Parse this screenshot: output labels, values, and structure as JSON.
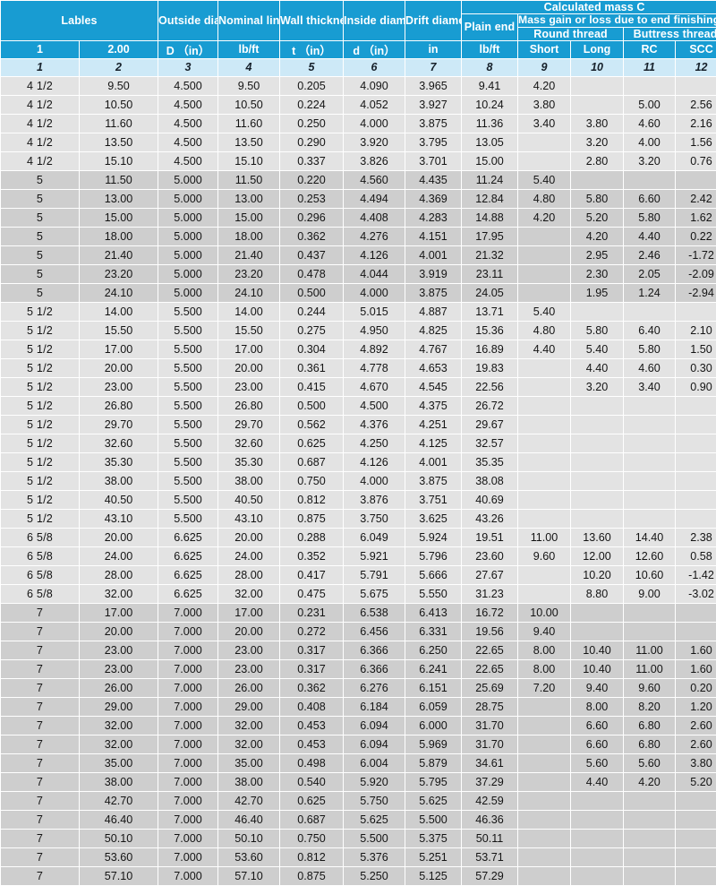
{
  "table": {
    "header": {
      "labels": "Lables",
      "outside_diameter": "Outside diameter",
      "nominal_linear_mass": "Nominal linear mass T&C",
      "wall_thickness": "Wall thickness",
      "inside_diameter": "Inside diameter",
      "drift_diameter": "Drift diameter",
      "calculated_mass": "Calculated mass C",
      "plain_end": "Plain end",
      "mass_gain_loss": "Mass gain or loss due to end finishing  (lb)",
      "round_thread": "Round thread",
      "buttress_thread": "Buttress thread"
    },
    "units_row": {
      "label1": "1",
      "label2": "2.00",
      "outside_diameter": "D （in）",
      "nominal_linear_mass": "lb/ft",
      "wall_thickness": "t （in）",
      "inside_diameter": "d （in）",
      "drift_diameter": "in",
      "plain_end": "lb/ft",
      "short": "Short",
      "long": "Long",
      "rc": "RC",
      "scc": "SCC"
    },
    "index_row": [
      "1",
      "2",
      "3",
      "4",
      "5",
      "6",
      "7",
      "8",
      "9",
      "10",
      "11",
      "12"
    ],
    "colors": {
      "header_blue": "#189CD2",
      "index_blue": "#CDE9F7",
      "band_light": "#E3E3E3",
      "band_dark": "#CECECE",
      "page_background": "#FFFFFF",
      "text": "#141414"
    },
    "rows": [
      {
        "band": "a",
        "cells": [
          "4 1/2",
          "9.50",
          "4.500",
          "9.50",
          "0.205",
          "4.090",
          "3.965",
          "9.41",
          "4.20",
          "",
          "",
          ""
        ]
      },
      {
        "band": "a",
        "cells": [
          "4 1/2",
          "10.50",
          "4.500",
          "10.50",
          "0.224",
          "4.052",
          "3.927",
          "10.24",
          "3.80",
          "",
          "5.00",
          "2.56"
        ]
      },
      {
        "band": "a",
        "cells": [
          "4 1/2",
          "11.60",
          "4.500",
          "11.60",
          "0.250",
          "4.000",
          "3.875",
          "11.36",
          "3.40",
          "3.80",
          "4.60",
          "2.16"
        ]
      },
      {
        "band": "a",
        "cells": [
          "4 1/2",
          "13.50",
          "4.500",
          "13.50",
          "0.290",
          "3.920",
          "3.795",
          "13.05",
          "",
          "3.20",
          "4.00",
          "1.56"
        ]
      },
      {
        "band": "a",
        "cells": [
          "4 1/2",
          "15.10",
          "4.500",
          "15.10",
          "0.337",
          "3.826",
          "3.701",
          "15.00",
          "",
          "2.80",
          "3.20",
          "0.76"
        ]
      },
      {
        "band": "b",
        "cells": [
          "5",
          "11.50",
          "5.000",
          "11.50",
          "0.220",
          "4.560",
          "4.435",
          "11.24",
          "5.40",
          "",
          "",
          ""
        ]
      },
      {
        "band": "b",
        "cells": [
          "5",
          "13.00",
          "5.000",
          "13.00",
          "0.253",
          "4.494",
          "4.369",
          "12.84",
          "4.80",
          "5.80",
          "6.60",
          "2.42"
        ]
      },
      {
        "band": "b",
        "cells": [
          "5",
          "15.00",
          "5.000",
          "15.00",
          "0.296",
          "4.408",
          "4.283",
          "14.88",
          "4.20",
          "5.20",
          "5.80",
          "1.62"
        ]
      },
      {
        "band": "b",
        "cells": [
          "5",
          "18.00",
          "5.000",
          "18.00",
          "0.362",
          "4.276",
          "4.151",
          "17.95",
          "",
          "4.20",
          "4.40",
          "0.22"
        ]
      },
      {
        "band": "b",
        "cells": [
          "5",
          "21.40",
          "5.000",
          "21.40",
          "0.437",
          "4.126",
          "4.001",
          "21.32",
          "",
          "2.95",
          "2.46",
          "-1.72"
        ]
      },
      {
        "band": "b",
        "cells": [
          "5",
          "23.20",
          "5.000",
          "23.20",
          "0.478",
          "4.044",
          "3.919",
          "23.11",
          "",
          "2.30",
          "2.05",
          "-2.09"
        ]
      },
      {
        "band": "b",
        "cells": [
          "5",
          "24.10",
          "5.000",
          "24.10",
          "0.500",
          "4.000",
          "3.875",
          "24.05",
          "",
          "1.95",
          "1.24",
          "-2.94"
        ]
      },
      {
        "band": "a",
        "cells": [
          "5 1/2",
          "14.00",
          "5.500",
          "14.00",
          "0.244",
          "5.015",
          "4.887",
          "13.71",
          "5.40",
          "",
          "",
          ""
        ]
      },
      {
        "band": "a",
        "cells": [
          "5 1/2",
          "15.50",
          "5.500",
          "15.50",
          "0.275",
          "4.950",
          "4.825",
          "15.36",
          "4.80",
          "5.80",
          "6.40",
          "2.10"
        ]
      },
      {
        "band": "a",
        "cells": [
          "5 1/2",
          "17.00",
          "5.500",
          "17.00",
          "0.304",
          "4.892",
          "4.767",
          "16.89",
          "4.40",
          "5.40",
          "5.80",
          "1.50"
        ]
      },
      {
        "band": "a",
        "cells": [
          "5 1/2",
          "20.00",
          "5.500",
          "20.00",
          "0.361",
          "4.778",
          "4.653",
          "19.83",
          "",
          "4.40",
          "4.60",
          "0.30"
        ]
      },
      {
        "band": "a",
        "cells": [
          "5 1/2",
          "23.00",
          "5.500",
          "23.00",
          "0.415",
          "4.670",
          "4.545",
          "22.56",
          "",
          "3.20",
          "3.40",
          "0.90"
        ]
      },
      {
        "band": "a",
        "cells": [
          "5 1/2",
          "26.80",
          "5.500",
          "26.80",
          "0.500",
          "4.500",
          "4.375",
          "26.72",
          "",
          "",
          "",
          ""
        ]
      },
      {
        "band": "a",
        "cells": [
          "5 1/2",
          "29.70",
          "5.500",
          "29.70",
          "0.562",
          "4.376",
          "4.251",
          "29.67",
          "",
          "",
          "",
          ""
        ]
      },
      {
        "band": "a",
        "cells": [
          "5 1/2",
          "32.60",
          "5.500",
          "32.60",
          "0.625",
          "4.250",
          "4.125",
          "32.57",
          "",
          "",
          "",
          ""
        ]
      },
      {
        "band": "a",
        "cells": [
          "5 1/2",
          "35.30",
          "5.500",
          "35.30",
          "0.687",
          "4.126",
          "4.001",
          "35.35",
          "",
          "",
          "",
          ""
        ]
      },
      {
        "band": "a",
        "cells": [
          "5 1/2",
          "38.00",
          "5.500",
          "38.00",
          "0.750",
          "4.000",
          "3.875",
          "38.08",
          "",
          "",
          "",
          ""
        ]
      },
      {
        "band": "a",
        "cells": [
          "5 1/2",
          "40.50",
          "5.500",
          "40.50",
          "0.812",
          "3.876",
          "3.751",
          "40.69",
          "",
          "",
          "",
          ""
        ]
      },
      {
        "band": "a",
        "cells": [
          "5 1/2",
          "43.10",
          "5.500",
          "43.10",
          "0.875",
          "3.750",
          "3.625",
          "43.26",
          "",
          "",
          "",
          ""
        ]
      },
      {
        "band": "a",
        "cells": [
          "6 5/8",
          "20.00",
          "6.625",
          "20.00",
          "0.288",
          "6.049",
          "5.924",
          "19.51",
          "11.00",
          "13.60",
          "14.40",
          "2.38"
        ]
      },
      {
        "band": "a",
        "cells": [
          "6 5/8",
          "24.00",
          "6.625",
          "24.00",
          "0.352",
          "5.921",
          "5.796",
          "23.60",
          "9.60",
          "12.00",
          "12.60",
          "0.58"
        ]
      },
      {
        "band": "a",
        "cells": [
          "6 5/8",
          "28.00",
          "6.625",
          "28.00",
          "0.417",
          "5.791",
          "5.666",
          "27.67",
          "",
          "10.20",
          "10.60",
          "-1.42"
        ]
      },
      {
        "band": "a",
        "cells": [
          "6 5/8",
          "32.00",
          "6.625",
          "32.00",
          "0.475",
          "5.675",
          "5.550",
          "31.23",
          "",
          "8.80",
          "9.00",
          "-3.02"
        ]
      },
      {
        "band": "b",
        "cells": [
          "7",
          "17.00",
          "7.000",
          "17.00",
          "0.231",
          "6.538",
          "6.413",
          "16.72",
          "10.00",
          "",
          "",
          ""
        ]
      },
      {
        "band": "b",
        "cells": [
          "7",
          "20.00",
          "7.000",
          "20.00",
          "0.272",
          "6.456",
          "6.331",
          "19.56",
          "9.40",
          "",
          "",
          ""
        ]
      },
      {
        "band": "b",
        "cells": [
          "7",
          "23.00",
          "7.000",
          "23.00",
          "0.317",
          "6.366",
          "6.250",
          "22.65",
          "8.00",
          "10.40",
          "11.00",
          "1.60"
        ]
      },
      {
        "band": "b",
        "cells": [
          "7",
          "23.00",
          "7.000",
          "23.00",
          "0.317",
          "6.366",
          "6.241",
          "22.65",
          "8.00",
          "10.40",
          "11.00",
          "1.60"
        ]
      },
      {
        "band": "b",
        "cells": [
          "7",
          "26.00",
          "7.000",
          "26.00",
          "0.362",
          "6.276",
          "6.151",
          "25.69",
          "7.20",
          "9.40",
          "9.60",
          "0.20"
        ]
      },
      {
        "band": "b",
        "cells": [
          "7",
          "29.00",
          "7.000",
          "29.00",
          "0.408",
          "6.184",
          "6.059",
          "28.75",
          "",
          "8.00",
          "8.20",
          "1.20"
        ]
      },
      {
        "band": "b",
        "cells": [
          "7",
          "32.00",
          "7.000",
          "32.00",
          "0.453",
          "6.094",
          "6.000",
          "31.70",
          "",
          "6.60",
          "6.80",
          "2.60"
        ]
      },
      {
        "band": "b",
        "cells": [
          "7",
          "32.00",
          "7.000",
          "32.00",
          "0.453",
          "6.094",
          "5.969",
          "31.70",
          "",
          "6.60",
          "6.80",
          "2.60"
        ]
      },
      {
        "band": "b",
        "cells": [
          "7",
          "35.00",
          "7.000",
          "35.00",
          "0.498",
          "6.004",
          "5.879",
          "34.61",
          "",
          "5.60",
          "5.60",
          "3.80"
        ]
      },
      {
        "band": "b",
        "cells": [
          "7",
          "38.00",
          "7.000",
          "38.00",
          "0.540",
          "5.920",
          "5.795",
          "37.29",
          "",
          "4.40",
          "4.20",
          "5.20"
        ]
      },
      {
        "band": "b",
        "cells": [
          "7",
          "42.70",
          "7.000",
          "42.70",
          "0.625",
          "5.750",
          "5.625",
          "42.59",
          "",
          "",
          "",
          ""
        ]
      },
      {
        "band": "b",
        "cells": [
          "7",
          "46.40",
          "7.000",
          "46.40",
          "0.687",
          "5.625",
          "5.500",
          "46.36",
          "",
          "",
          "",
          ""
        ]
      },
      {
        "band": "b",
        "cells": [
          "7",
          "50.10",
          "7.000",
          "50.10",
          "0.750",
          "5.500",
          "5.375",
          "50.11",
          "",
          "",
          "",
          ""
        ]
      },
      {
        "band": "b",
        "cells": [
          "7",
          "53.60",
          "7.000",
          "53.60",
          "0.812",
          "5.376",
          "5.251",
          "53.71",
          "",
          "",
          "",
          ""
        ]
      },
      {
        "band": "b",
        "cells": [
          "7",
          "57.10",
          "7.000",
          "57.10",
          "0.875",
          "5.250",
          "5.125",
          "57.29",
          "",
          "",
          "",
          ""
        ]
      }
    ]
  }
}
